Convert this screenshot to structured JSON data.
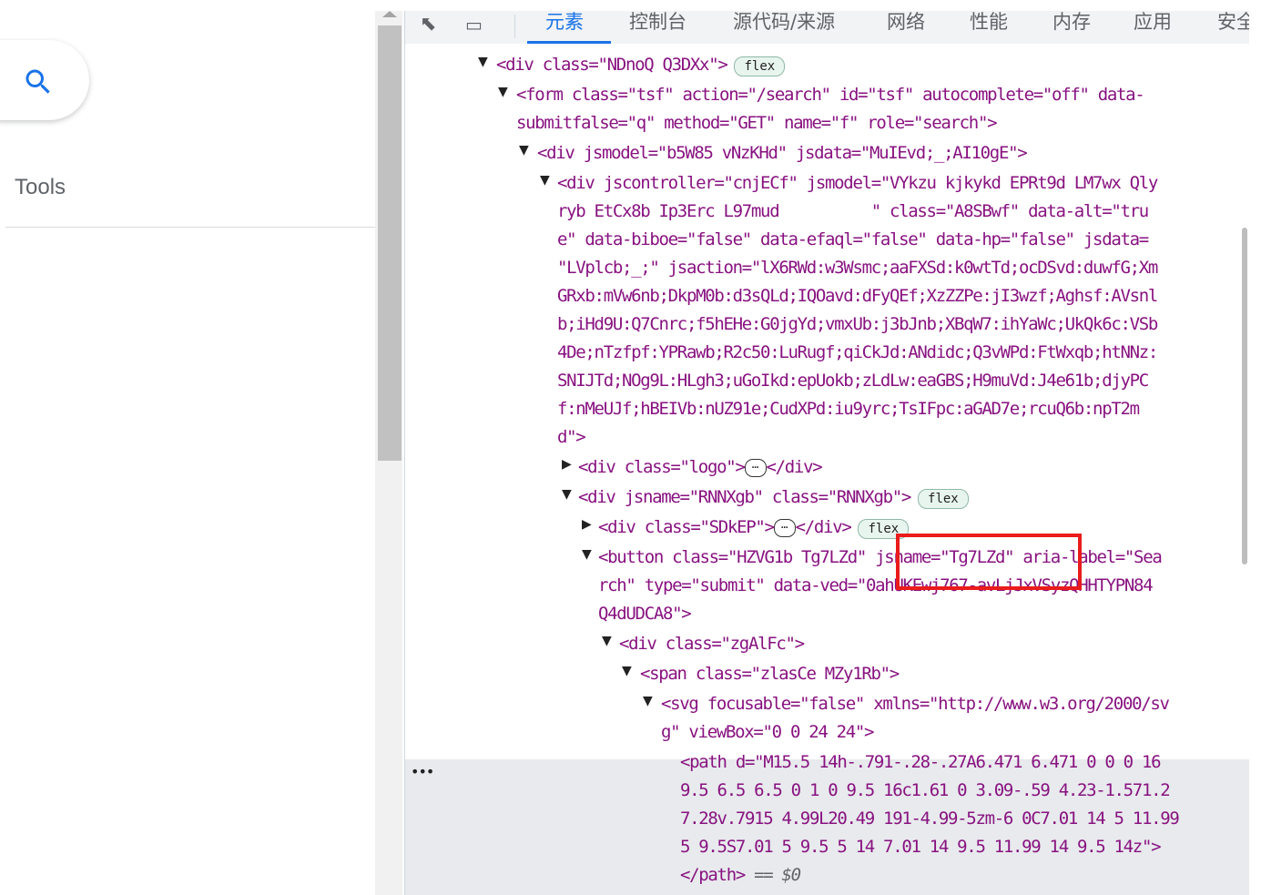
{
  "left_panel": {
    "tools_label": "Tools"
  },
  "devtools": {
    "toolbar": {
      "inspect_icon": "inspect-element-icon",
      "device_icon": "device-toggle-icon",
      "tabs": [
        "元素",
        "控制台",
        "源代码/来源",
        "网络",
        "性能",
        "内存",
        "应用",
        "安全"
      ]
    },
    "lines": [
      "<div class=\"NDnoQ Q3DXx\">",
      "<form class=\"tsf\" action=\"/search\" id=\"tsf\" autocomplete=\"off\" data-",
      "submitfalse=\"q\" method=\"GET\" name=\"f\" role=\"search\">",
      "<div jsmodel=\"b5W85 vNzKHd\" jsdata=\"MuIEvd;_;AI10gE\">",
      "<div jscontroller=\"cnjECf\" jsmodel=\"VYkzu kjkykd EPRt9d LM7wx Qly",
      "ryb EtCx8b Ip3Erc L97mud          \" class=\"A8SBwf\" data-alt=\"tru",
      "e\" data-biboe=\"false\" data-efaql=\"false\" data-hp=\"false\" jsdata=",
      "\"LVplcb;_;\" jsaction=\"lX6RWd:w3Wsmc;aaFXSd:k0wtTd;ocDSvd:duwfG;Xm",
      "GRxb:mVw6nb;DkpM0b:d3sQLd;IQOavd:dFyQEf;XzZZPe:jI3wzf;Aghsf:AVsnl",
      "b;iHd9U:Q7Cnrc;f5hEHe:G0jgYd;vmxUb:j3bJnb;XBqW7:ihYaWc;UkQk6c:VSb",
      "4De;nTzfpf:YPRawb;R2c50:LuRugf;qiCkJd:ANdidc;Q3vWPd:FtWxqb;htNNz:",
      "SNIJTd;NOg9L:HLgh3;uGoIkd:epUokb;zLdLw:eaGBS;H9muVd:J4e61b;djyPC",
      "f:nMeUJf;hBEIVb:nUZ91e;CudXPd:iu9yrc;TsIFpc:aGAD7e;rcuQ6b:npT2m",
      "d\">",
      "<div class=\"logo\">",
      "<div jsname=\"RNNXgb\" class=\"RNNXgb\">",
      "<div class=\"SDkEP\">",
      "<button class=\"HZVG1b Tg7LZd\" jsname=\"Tg7LZd\" aria-label=\"Sea",
      "rch\" type=\"submit\" data-ved=\"0ahUKEwj767-avLjJxVSyzQHHTYPN84",
      "Q4dUDCA8\">",
      "<div class=\"zgAlFc\">",
      "<span class=\"zlasCe MZy1Rb\">",
      "<svg focusable=\"false\" xmlns=\"http://www.w3.org/2000/sv",
      "g\" viewBox=\"0 0 24 24\">",
      "<path d=\"M15.5 14h-.791-.28-.27A6.471 6.471 0 0 0 16",
      "9.5 6.5 6.5 0 1 0 9.5 16c1.61 0 3.09-.59 4.23-1.571.2",
      "7.28v.7915 4.99L20.49 191-4.99-5zm-6 0C7.01 14 5 11.99",
      "5 9.5S7.01 5 9.5 5 14 7.01 14 9.5 11.99 14 9.5 14z\">",
      "</path>"
    ],
    "flex_badge": "flex",
    "ellipsis": "⋯",
    "close_div": "</div>",
    "selected_suffix": "== $0",
    "row_menu": "•••"
  }
}
